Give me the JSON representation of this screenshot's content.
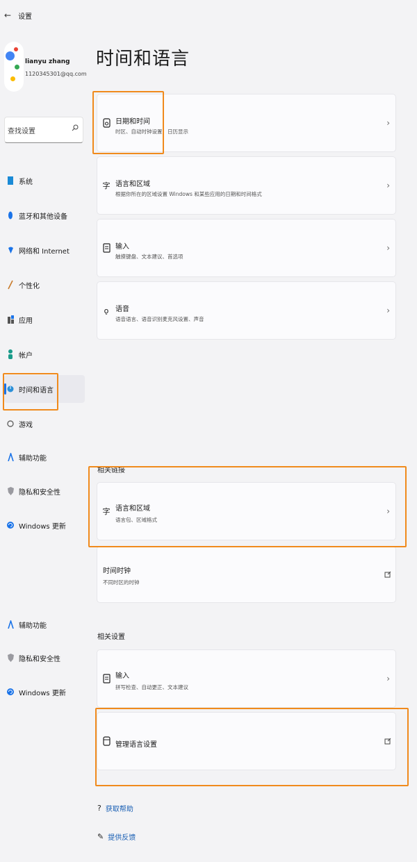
{
  "window": {
    "back_icon": "back-arrow-icon",
    "title": "设置"
  },
  "profile": {
    "name": "lianyu zhang",
    "email": "1120345301@qq.com"
  },
  "search": {
    "placeholder": "查找设置"
  },
  "sidebar": {
    "items": [
      {
        "label": "系统",
        "icon": "system-icon"
      },
      {
        "label": "蓝牙和其他设备",
        "icon": "bluetooth-icon"
      },
      {
        "label": "网络和 Internet",
        "icon": "network-icon"
      },
      {
        "label": "个性化",
        "icon": "personalization-icon"
      },
      {
        "label": "应用",
        "icon": "apps-icon"
      },
      {
        "label": "帐户",
        "icon": "account-icon"
      },
      {
        "label": "时间和语言",
        "icon": "time-language-icon",
        "active": true
      },
      {
        "label": "游戏",
        "icon": "gaming-icon"
      },
      {
        "label": "辅助功能",
        "icon": "accessibility-icon"
      },
      {
        "label": "隐私和安全性",
        "icon": "privacy-icon"
      },
      {
        "label": "Windows 更新",
        "icon": "windows-update-icon"
      }
    ],
    "extra_items": [
      {
        "label": "辅助功能",
        "icon": "accessibility-icon"
      },
      {
        "label": "隐私和安全性",
        "icon": "privacy-icon"
      },
      {
        "label": "Windows 更新",
        "icon": "windows-update-icon"
      }
    ]
  },
  "main": {
    "title": "时间和语言",
    "cards": [
      {
        "title": "日期和时间",
        "subtitle": "时区、自动时钟设置、日历显示",
        "icon": "clock-icon"
      },
      {
        "title": "语言和区域",
        "subtitle": "根据你所在的区域设置 Windows 和某些应用的日期和时间格式",
        "icon": "language-region-icon"
      },
      {
        "title": "输入",
        "subtitle": "触摸键盘、文本建议、首选项",
        "icon": "keyboard-icon"
      },
      {
        "title": "语音",
        "subtitle": "语音语言、语音识别麦克风设置、声音",
        "icon": "speech-icon"
      }
    ],
    "related_links": {
      "heading": "相关链接",
      "cards": [
        {
          "title": "语言和区域",
          "subtitle": "语言包、区域格式",
          "icon": "language-region-icon"
        },
        {
          "title": "时间时钟",
          "subtitle": "不同时区的时钟",
          "icon": "external-link-icon"
        }
      ]
    },
    "related_settings": {
      "heading": "相关设置",
      "cards": [
        {
          "title": "输入",
          "subtitle": "拼写检查、自动更正、文本建议",
          "icon": "keyboard-icon"
        },
        {
          "title": "管理语言设置",
          "icon": "manage-language-icon"
        }
      ]
    },
    "footer_links": [
      {
        "label": "获取帮助",
        "icon": "help-icon"
      },
      {
        "label": "提供反馈",
        "icon": "feedback-icon"
      }
    ]
  },
  "colors": {
    "accent": "#1a73e8",
    "highlight": "#f08a1c",
    "background": "#f3f3f5",
    "card": "#fbfbfd"
  }
}
